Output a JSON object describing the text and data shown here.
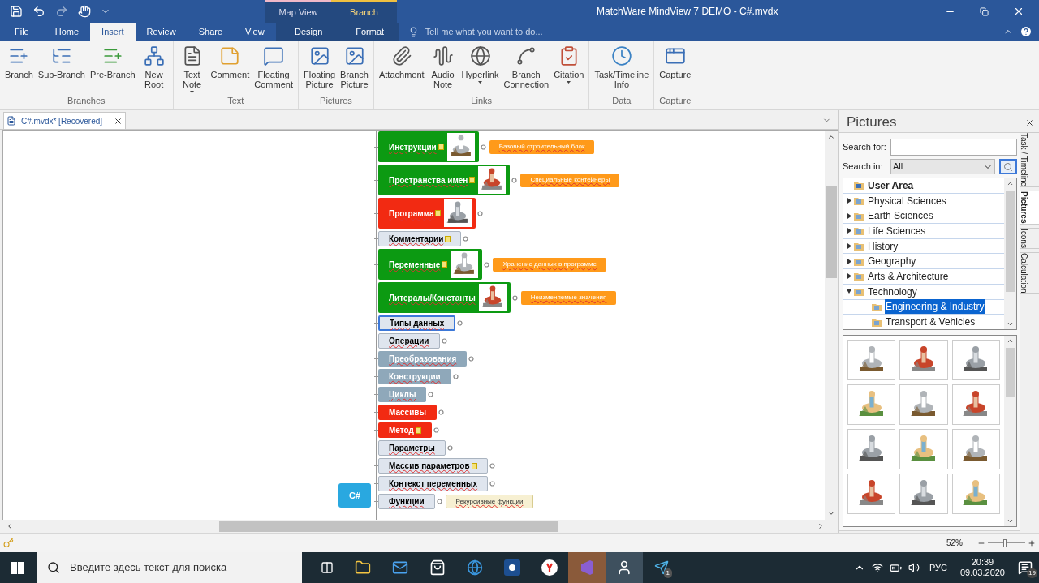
{
  "window": {
    "title": "MatchWare MindView 7 DEMO - C#.mvdx"
  },
  "context_groups": [
    {
      "label": "Map View"
    },
    {
      "label": "Branch"
    }
  ],
  "tabs": [
    {
      "label": "File",
      "selected": false,
      "contextual": false
    },
    {
      "label": "Home",
      "selected": false,
      "contextual": false
    },
    {
      "label": "Insert",
      "selected": true,
      "contextual": false
    },
    {
      "label": "Review",
      "selected": false,
      "contextual": false
    },
    {
      "label": "Share",
      "selected": false,
      "contextual": false
    },
    {
      "label": "View",
      "selected": false,
      "contextual": false
    },
    {
      "label": "Design",
      "selected": false,
      "contextual": true
    },
    {
      "label": "Format",
      "selected": false,
      "contextual": true
    }
  ],
  "tell_me": {
    "placeholder": "Tell me what you want to do..."
  },
  "ribbon": [
    {
      "label": "Branches",
      "buttons": [
        {
          "label": "Branch",
          "dropdown": false
        },
        {
          "label": "Sub-Branch",
          "dropdown": false
        },
        {
          "label": "Pre-Branch",
          "dropdown": false
        },
        {
          "label": "New\nRoot",
          "dropdown": false
        }
      ]
    },
    {
      "label": "Text",
      "buttons": [
        {
          "label": "Text\nNote",
          "dropdown": true
        },
        {
          "label": "Comment",
          "dropdown": false
        },
        {
          "label": "Floating\nComment",
          "dropdown": false
        }
      ]
    },
    {
      "label": "Pictures",
      "buttons": [
        {
          "label": "Floating\nPicture",
          "dropdown": false
        },
        {
          "label": "Branch\nPicture",
          "dropdown": false
        }
      ]
    },
    {
      "label": "Links",
      "buttons": [
        {
          "label": "Attachment",
          "dropdown": false
        },
        {
          "label": "Audio\nNote",
          "dropdown": false
        },
        {
          "label": "Hyperlink",
          "dropdown": true
        },
        {
          "label": "Branch\nConnection",
          "dropdown": false
        },
        {
          "label": "Citation",
          "dropdown": true
        }
      ]
    },
    {
      "label": "Data",
      "buttons": [
        {
          "label": "Task/Timeline\nInfo",
          "dropdown": false
        }
      ]
    },
    {
      "label": "Capture",
      "buttons": [
        {
          "label": "Capture",
          "dropdown": false
        }
      ]
    }
  ],
  "document_tab": {
    "label": "C#.mvdx* [Recovered]"
  },
  "mindmap": {
    "root": {
      "label": "C#"
    },
    "branches": [
      {
        "label": "Инструкции",
        "color": "#0c9a12",
        "note": true,
        "picture": true,
        "selected": false,
        "callout": {
          "text": "Базовый строительный блок",
          "color": "#ff9a1a"
        }
      },
      {
        "label": "Пространства имен",
        "color": "#0c9a12",
        "note": true,
        "picture": true,
        "selected": false,
        "callout": {
          "text": "Специальные контейнеры",
          "color": "#ff9a1a"
        }
      },
      {
        "label": "Программа",
        "color": "#f22a12",
        "note": true,
        "picture": true,
        "selected": false
      },
      {
        "label": "Комментарии",
        "color": "#dfe5ee",
        "note": true,
        "picture": false,
        "selected": false
      },
      {
        "label": "Переменные",
        "color": "#0c9a12",
        "note": true,
        "picture": true,
        "selected": false,
        "callout": {
          "text": "Хранение данных в программе",
          "color": "#ff9a1a"
        }
      },
      {
        "label": "Литералы/Константы",
        "color": "#0c9a12",
        "note": false,
        "picture": true,
        "selected": false,
        "callout": {
          "text": "Неизменяемые значения",
          "color": "#ff9a1a"
        }
      },
      {
        "label": "Типы данных",
        "color": "#dfe5ee",
        "note": false,
        "picture": false,
        "selected": true
      },
      {
        "label": "Операции",
        "color": "#dfe5ee",
        "note": false,
        "picture": false,
        "selected": false
      },
      {
        "label": "Преобразования",
        "color": "#8fa8ba",
        "note": false,
        "picture": false,
        "selected": false
      },
      {
        "label": "Конструкции",
        "color": "#8fa8ba",
        "note": false,
        "picture": false,
        "selected": false
      },
      {
        "label": "Циклы",
        "color": "#8fa8ba",
        "note": false,
        "picture": false,
        "selected": false
      },
      {
        "label": "Массивы",
        "color": "#f22a12",
        "note": false,
        "picture": false,
        "selected": false
      },
      {
        "label": "Метод",
        "color": "#f22a12",
        "note": true,
        "picture": false,
        "selected": false
      },
      {
        "label": "Параметры",
        "color": "#dfe5ee",
        "note": false,
        "picture": false,
        "selected": false
      },
      {
        "label": "Массив параметров",
        "color": "#dfe5ee",
        "note": true,
        "picture": false,
        "selected": false
      },
      {
        "label": "Контекст переменных",
        "color": "#dfe5ee",
        "note": false,
        "picture": false,
        "selected": false
      },
      {
        "label": "Функции",
        "color": "#dfe5ee",
        "note": false,
        "picture": false,
        "selected": false,
        "callout": {
          "text": "Рекурсивные функции",
          "color": "#f7f0d2"
        }
      }
    ]
  },
  "pictures_panel": {
    "title": "Pictures",
    "search_for": {
      "label": "Search for:"
    },
    "search_in": {
      "label": "Search in:",
      "value": "All"
    },
    "tree": [
      {
        "label": "User Area",
        "kind": "user",
        "selected": false
      },
      {
        "label": "Physical Sciences",
        "kind": "folder",
        "expanded": false,
        "selected": false
      },
      {
        "label": "Earth Sciences",
        "kind": "folder",
        "expanded": false,
        "selected": false
      },
      {
        "label": "Life Sciences",
        "kind": "folder",
        "expanded": false,
        "selected": false
      },
      {
        "label": "History",
        "kind": "folder",
        "expanded": false,
        "selected": false
      },
      {
        "label": "Geography",
        "kind": "folder",
        "expanded": false,
        "selected": false
      },
      {
        "label": "Arts & Architecture",
        "kind": "folder",
        "expanded": false,
        "selected": false
      },
      {
        "label": "Technology",
        "kind": "folder",
        "expanded": true,
        "selected": false,
        "children": [
          {
            "label": "Engineering & Industry",
            "selected": true
          },
          {
            "label": "Transport & Vehicles",
            "selected": false
          }
        ]
      }
    ]
  },
  "side_tabs": [
    {
      "label": "Task / Timeline",
      "selected": false
    },
    {
      "label": "Pictures",
      "selected": true
    },
    {
      "label": "Icons",
      "selected": false
    },
    {
      "label": "Calculation",
      "selected": false
    }
  ],
  "status_bar": {
    "zoom": "52%",
    "zoom_slider": {
      "level": 0.45
    }
  },
  "taskbar": {
    "search": {
      "placeholder": "Введите здесь текст для поиска"
    },
    "telegram_badge": "1",
    "language": "РУС",
    "time": "20:39",
    "date": "09.03.2020",
    "notifications": "19"
  }
}
